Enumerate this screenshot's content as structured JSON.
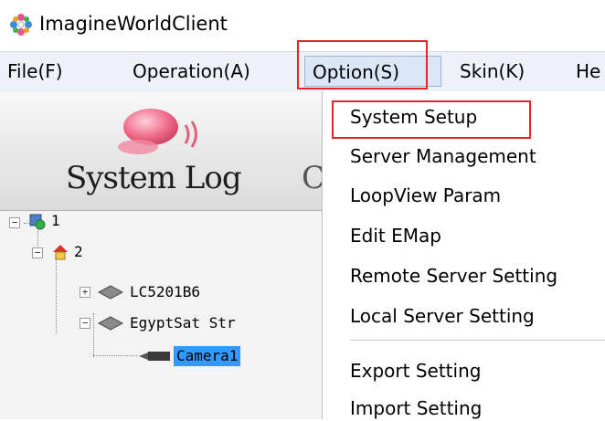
{
  "window": {
    "title": "ImagineWorldClient",
    "icon": "app-flower-icon"
  },
  "menubar": {
    "items": [
      {
        "label": "File(F)"
      },
      {
        "label": "Operation(A)"
      },
      {
        "label": "Option(S)"
      },
      {
        "label": "Skin(K)"
      },
      {
        "label": "He"
      }
    ]
  },
  "panel": {
    "system_log_label": "System Log",
    "next_char": "C"
  },
  "tree": {
    "nodes": [
      {
        "label": "1"
      },
      {
        "label": "2"
      },
      {
        "label": "LC5201B6"
      },
      {
        "label": "EgyptSat Str"
      },
      {
        "label": "Camera1"
      }
    ]
  },
  "option_menu": {
    "items": [
      {
        "label": "System Setup"
      },
      {
        "label": "Server Management"
      },
      {
        "label": "LoopView Param"
      },
      {
        "label": "Edit EMap"
      },
      {
        "label": "Remote Server Setting"
      },
      {
        "label": "Local Server Setting"
      },
      {
        "label": "Export Setting"
      },
      {
        "label": "Import Setting"
      }
    ]
  },
  "colors": {
    "highlight": "#e5252a",
    "tree_selection": "#3399ff",
    "menu_selected_bg": "#dbe7f7"
  }
}
